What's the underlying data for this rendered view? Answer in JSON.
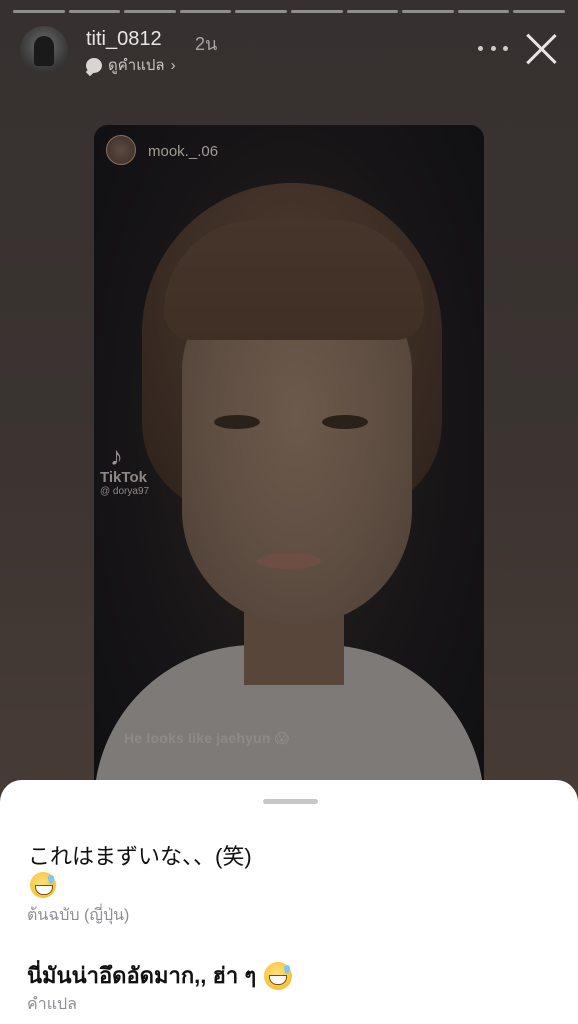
{
  "story": {
    "segments": 10,
    "username": "titi_0812",
    "time_ago": "2น",
    "see_translation": "ดูคำแปล",
    "chevron": "›"
  },
  "card": {
    "username": "mook._.06",
    "tiktok_brand": "TikTok",
    "tiktok_handle": "@ dorya97",
    "caption": "He looks like jaehyun 😱"
  },
  "sheet": {
    "original_text": "これはまずいな、、(笑)",
    "original_label": "ต้นฉบับ (ญี่ปุ่น)",
    "translated_text": "นี่มันน่าอึดอัดมาก,, ฮ่า ๆ",
    "translated_label": "คำแปล"
  },
  "icons": {
    "more": "more-horizontal-icon",
    "close": "close-icon",
    "translate": "speech-bubble-icon",
    "emoji": "grinning-sweat-emoji"
  }
}
